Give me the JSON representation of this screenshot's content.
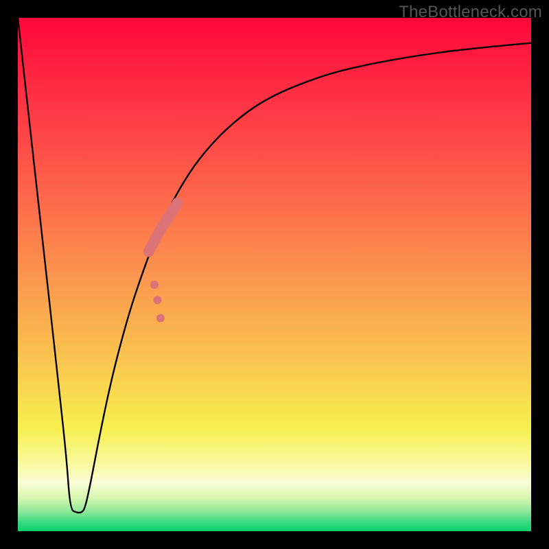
{
  "watermark": "TheBottleneck.com",
  "colors": {
    "frame": "#000000",
    "curve": "#000000",
    "points": "#DC7377",
    "gradient_stops": [
      {
        "offset": 0.0,
        "color": "#FF073A"
      },
      {
        "offset": 0.18,
        "color": "#FE3845"
      },
      {
        "offset": 0.36,
        "color": "#FD6B4B"
      },
      {
        "offset": 0.52,
        "color": "#FB9A4E"
      },
      {
        "offset": 0.68,
        "color": "#F9C94F"
      },
      {
        "offset": 0.8,
        "color": "#F8EF4F"
      },
      {
        "offset": 0.875,
        "color": "#F9FBA7"
      },
      {
        "offset": 0.905,
        "color": "#FAFDD6"
      },
      {
        "offset": 0.935,
        "color": "#D7F6B0"
      },
      {
        "offset": 0.96,
        "color": "#93E99C"
      },
      {
        "offset": 0.985,
        "color": "#34D880"
      },
      {
        "offset": 1.0,
        "color": "#07D169"
      }
    ]
  },
  "chart_data": {
    "type": "line",
    "title": "",
    "xlabel": "",
    "ylabel": "",
    "xlim": [
      0,
      100
    ],
    "ylim": [
      0,
      100
    ],
    "grid": false,
    "series": [
      {
        "name": "bottleneck-curve",
        "x": [
          0,
          2,
          4,
          6,
          8,
          9.5,
          10.2,
          11.5,
          12.3,
          13.0,
          14.0,
          16.0,
          18.0,
          20.0,
          22.0,
          24.0,
          26.0,
          28.0,
          30.0,
          33.0,
          36.0,
          40.0,
          45.0,
          50.0,
          56.0,
          62.0,
          70.0,
          80.0,
          90.0,
          100.0
        ],
        "y": [
          100,
          82,
          64,
          46,
          28,
          14,
          4.2,
          3.6,
          3.6,
          4.2,
          8.5,
          19.0,
          28.5,
          36.5,
          43.5,
          49.5,
          55.0,
          59.8,
          64.0,
          69.2,
          73.4,
          77.8,
          82.0,
          85.0,
          87.5,
          89.5,
          91.3,
          93.0,
          94.2,
          95.1
        ]
      }
    ],
    "scatter": {
      "name": "highlight-points",
      "x": [
        25.5,
        25.9,
        26.3,
        26.7,
        27.1,
        27.5,
        27.9,
        28.3,
        28.7,
        29.1,
        29.5,
        29.9,
        30.3,
        30.7,
        31.1,
        26.6,
        27.2,
        27.8
      ],
      "y": [
        54.5,
        55.3,
        56.0,
        56.8,
        57.5,
        58.2,
        58.9,
        59.6,
        60.2,
        60.9,
        61.5,
        62.1,
        62.7,
        63.3,
        63.9,
        48.0,
        45.0,
        41.5
      ],
      "r": [
        8,
        8,
        8,
        8,
        8,
        8,
        8,
        8,
        8,
        8,
        8,
        8,
        8,
        8,
        8,
        6,
        6,
        6
      ]
    }
  }
}
